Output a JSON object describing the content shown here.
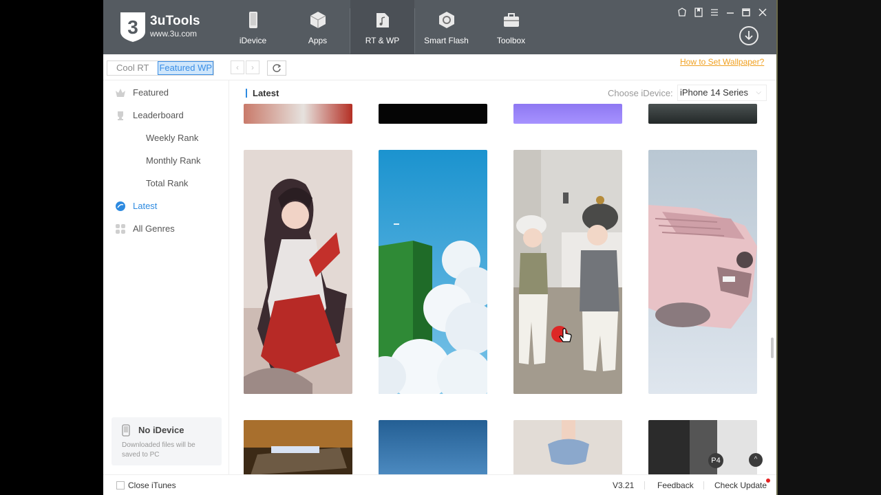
{
  "brand": {
    "name": "3uTools",
    "url": "www.3u.com"
  },
  "nav": [
    {
      "id": "idevice",
      "label": "iDevice"
    },
    {
      "id": "apps",
      "label": "Apps"
    },
    {
      "id": "rtwp",
      "label": "RT & WP"
    },
    {
      "id": "smartflash",
      "label": "Smart Flash"
    },
    {
      "id": "toolbox",
      "label": "Toolbox"
    }
  ],
  "toolbar": {
    "tab_cool_rt": "Cool RT",
    "tab_featured_wp": "Featured WP",
    "back_icon": "chevron-left-icon",
    "forward_icon": "chevron-right-icon",
    "refresh_icon": "refresh-icon",
    "how_to": "How to Set Wallpaper?"
  },
  "sidebar": {
    "items": [
      {
        "label": "Featured",
        "icon": "crown-icon"
      },
      {
        "label": "Leaderboard",
        "icon": "trophy-icon"
      },
      {
        "label": "Weekly Rank"
      },
      {
        "label": "Monthly Rank"
      },
      {
        "label": "Total Rank"
      },
      {
        "label": "Latest",
        "icon": "latest-icon"
      },
      {
        "label": "All Genres",
        "icon": "grid-icon"
      }
    ],
    "no_device": {
      "title": "No iDevice",
      "desc": "Downloaded files will be saved to PC"
    }
  },
  "content": {
    "heading": "Latest",
    "choose_label": "Choose iDevice:",
    "device_select": "iPhone 14 Series",
    "page_badge": "P4"
  },
  "status": {
    "close_itunes": "Close iTunes",
    "version": "V3.21",
    "feedback": "Feedback",
    "check_update": "Check Update"
  },
  "colors": {
    "titlebar": "#555b61",
    "accent": "#2d8ae0",
    "link_orange": "#f0a020"
  }
}
